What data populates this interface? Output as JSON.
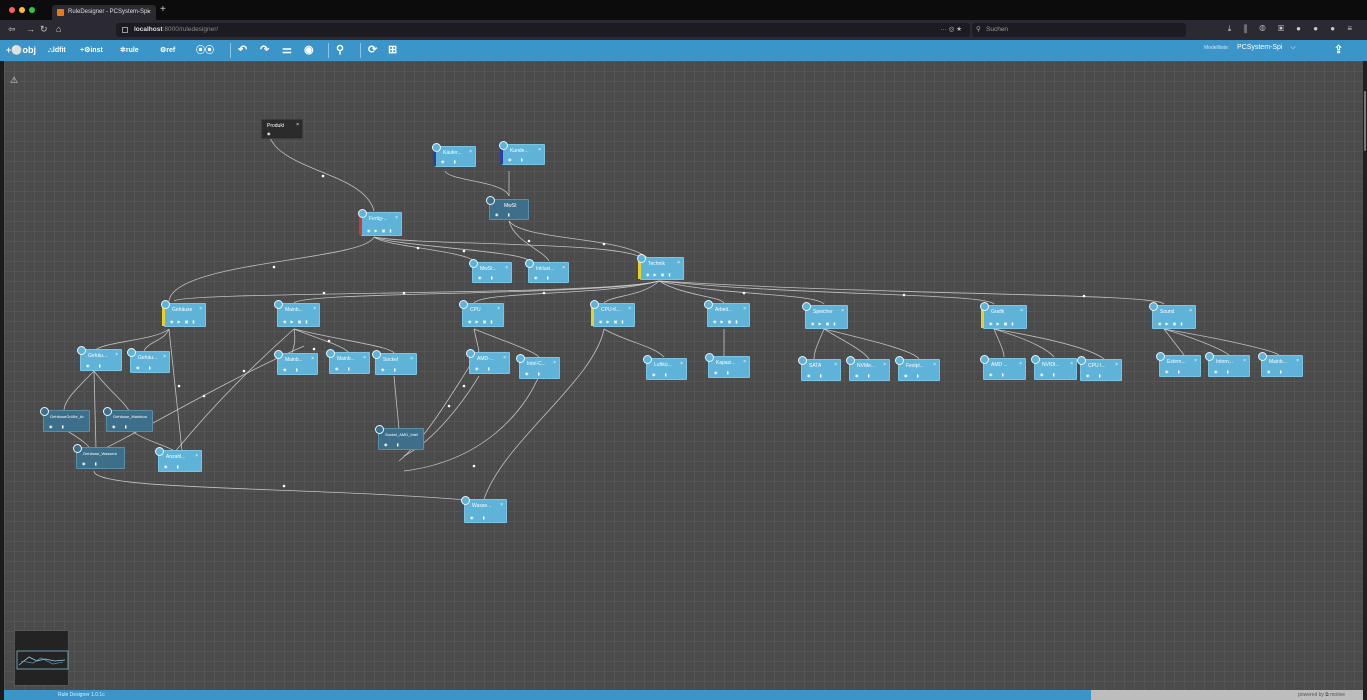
{
  "browser": {
    "tab_title": "RuleDesigner - PCSystem-Spi",
    "tab_close": "×",
    "new_tab": "+",
    "url_host": "localhost",
    "url_rest": ":8000/ruledesigner/",
    "search_placeholder": "Suchen",
    "url_actions": "··· ◎ ★",
    "nav_icons": "⤓ ⫼ ◍ ▣ ● ● ● ≡"
  },
  "toolbar": {
    "buttons": [
      "+⚪obj",
      "⛬ldfit",
      "+⚙inst",
      "✲rule",
      "⚙ref",
      "⦿⦿"
    ],
    "undo": "↶",
    "redo": "↷",
    "layout": "⚌",
    "target": "◉",
    "search": "⚲",
    "sync": "⟳",
    "grid": "⊞",
    "model_label": "Modellliste:",
    "model_value": "PCSystem-Spi",
    "model_chevron": "⌵",
    "export": "⇪"
  },
  "canvas": {
    "left_icon": "⚠",
    "nodes": {
      "produkt": "Produkt",
      "kaeufer": "Käufer...",
      "kunde": "Kunde...",
      "mwst": "MwSt",
      "fertig": "Fertig-...",
      "mwst2": "MwSt...",
      "inkl": "Inklusi...",
      "technik": "Technik",
      "gehaeuse": "Gehäuse",
      "mainb": "Mainb...",
      "cpu": "CPU",
      "cpuk": "CPU-K...",
      "arbeit": "Arbeit...",
      "speicher": "Speicher",
      "grafik": "Grafik",
      "sound": "Sound",
      "gehaeu1": "Gehäu...",
      "gehaeu2": "Gehäu...",
      "mainb1": "Mainb...",
      "mainb2": "Mainb...",
      "sockel": "Sockel",
      "amd": "AMD-...",
      "intel": "Intel-C...",
      "luftk": "Luftkü...",
      "kapaz": "Kapazi...",
      "sata": "SATA",
      "nvme": "NVMe...",
      "festpl": "Festpl...",
      "amd2": "AMD ...",
      "nvidia": "NVIDI...",
      "cpui": "CPU I...",
      "extern": "Extern...",
      "intern": "Intern...",
      "mainb3": "Mainb...",
      "gh_groesse": "GehäuseGröße_Ar",
      "gh_mainb": "Gehäuse_Mainboa",
      "gh_wasser": "Gehäuse_Wasserk",
      "anzahl": "Anzahl...",
      "sockel_amd": "Sockel_AMD_Intel",
      "wasser": "Wasse..."
    }
  },
  "footer": {
    "app_version": "Rule Designer  1.0.1c",
    "powered": "powered by ⧉ motive"
  }
}
